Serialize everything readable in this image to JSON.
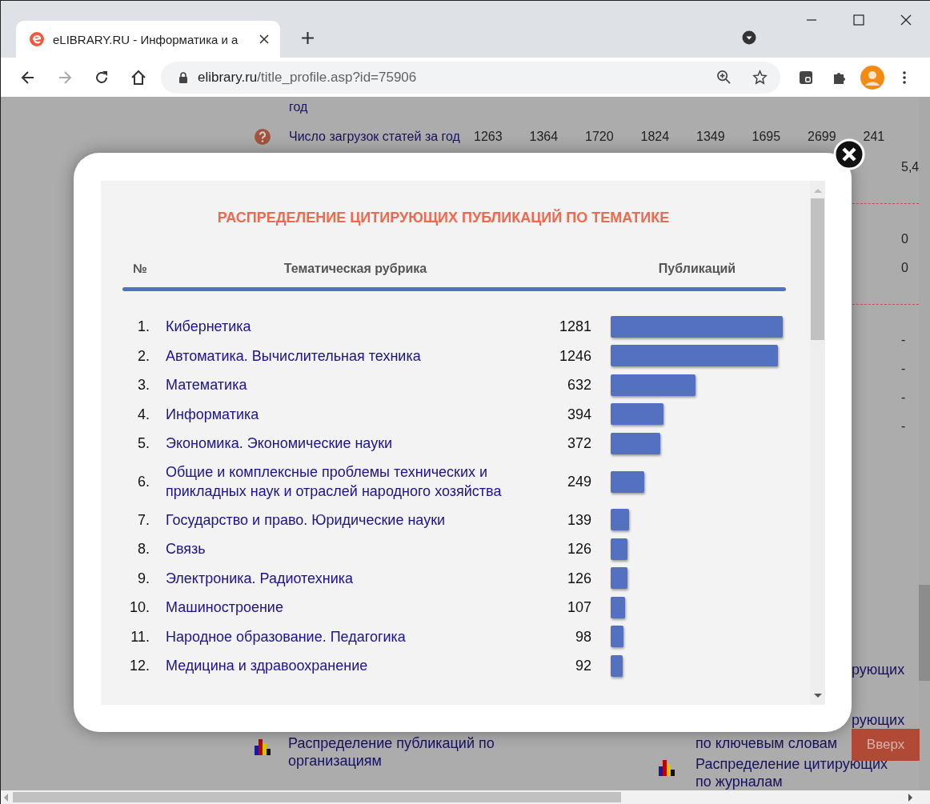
{
  "browser": {
    "tab": {
      "title": "eLIBRARY.RU - Информатика и а",
      "selected": true
    },
    "url_host": "elibrary.ru",
    "url_path": "/title_profile.asp?id=75906"
  },
  "background": {
    "rows": [
      {
        "kind": "text",
        "text": "год"
      },
      {
        "kind": "stat",
        "label": "Число загрузок статей за год",
        "values": [
          "1263",
          "1364",
          "1720",
          "1824",
          "1349",
          "1695",
          "2699",
          "241"
        ]
      },
      {
        "kind": "value",
        "value": "5,4"
      },
      {
        "kind": "rule"
      },
      {
        "kind": "value",
        "value": "0"
      },
      {
        "kind": "value",
        "value": "0"
      },
      {
        "kind": "rule"
      },
      {
        "kind": "value",
        "value": "-"
      },
      {
        "kind": "value",
        "value": "-"
      },
      {
        "kind": "value",
        "value": "-"
      },
      {
        "kind": "value",
        "value": "-"
      }
    ],
    "fragments": [
      {
        "text": "рующих"
      },
      {
        "text": "рующих",
        "second_line": "по ключевым словам"
      }
    ],
    "links": [
      {
        "text": "Распределение публикаций по организациям"
      },
      {
        "text": "Распределение цитирующих по журналам"
      }
    ],
    "top_button": "Вверх"
  },
  "modal": {
    "title": "РАСПРЕДЕЛЕНИЕ ЦИТИРУЮЩИХ ПУБЛИКАЦИЙ ПО ТЕМАТИКЕ",
    "columns": [
      "№",
      "Тематическая рубрика",
      "Публикаций"
    ],
    "rows": [
      {
        "number": "1.",
        "name": "Кибернетика",
        "count": "1281"
      },
      {
        "number": "2.",
        "name": "Автоматика. Вычислительная техника",
        "count": "1246"
      },
      {
        "number": "3.",
        "name": "Математика",
        "count": "632"
      },
      {
        "number": "4.",
        "name": "Информатика",
        "count": "394"
      },
      {
        "number": "5.",
        "name": "Экономика. Экономические науки",
        "count": "372"
      },
      {
        "number": "6.",
        "name": "Общие и комплексные проблемы технических и прикладных наук и отраслей народного хозяйства",
        "count": "249"
      },
      {
        "number": "7.",
        "name": "Государство и право. Юридические науки",
        "count": "139"
      },
      {
        "number": "8.",
        "name": "Связь",
        "count": "126"
      },
      {
        "number": "9.",
        "name": "Электроника. Радиотехника",
        "count": "126"
      },
      {
        "number": "10.",
        "name": "Машиностроение",
        "count": "107"
      },
      {
        "number": "11.",
        "name": "Народное образование. Педагогика",
        "count": "98"
      },
      {
        "number": "12.",
        "name": "Медицина и здравоохранение",
        "count": "92"
      }
    ]
  }
}
